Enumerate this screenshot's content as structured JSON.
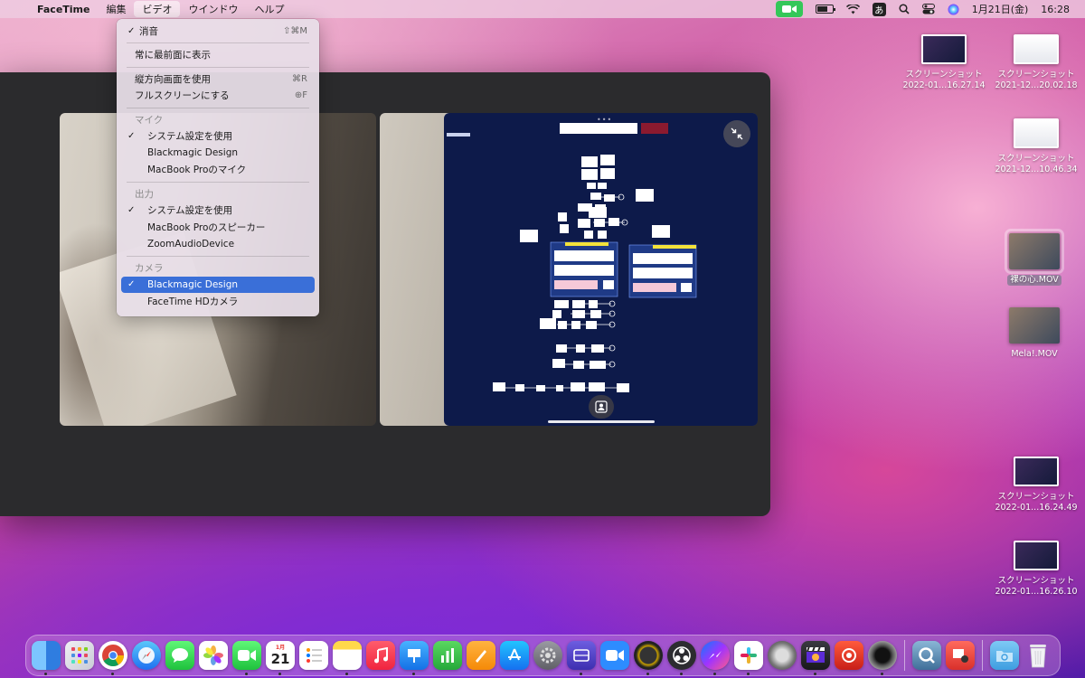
{
  "menubar": {
    "apple_glyph": "",
    "app_name": "FaceTime",
    "menus": [
      "編集",
      "ビデオ",
      "ウインドウ",
      "ヘルプ"
    ],
    "active_menu": "ビデオ",
    "input_method": "あ",
    "date": "1月21日(金)",
    "time": "16:28",
    "battery_level": 0.7
  },
  "video_menu": {
    "mute_label": "消音",
    "mute_shortcut": "⇧⌘M",
    "always_on_top_label": "常に最前面に表示",
    "portrait_label": "縦方向画面を使用",
    "portrait_shortcut": "⌘R",
    "fullscreen_label": "フルスクリーンにする",
    "fullscreen_shortcut": "⊕F",
    "mic_header": "マイク",
    "mic_items": [
      {
        "label": "システム設定を使用",
        "checked": true
      },
      {
        "label": "Blackmagic Design",
        "checked": false
      },
      {
        "label": "MacBook Proのマイク",
        "checked": false
      }
    ],
    "output_header": "出力",
    "output_items": [
      {
        "label": "システム設定を使用",
        "checked": true
      },
      {
        "label": "MacBook Proのスピーカー",
        "checked": false
      },
      {
        "label": "ZoomAudioDevice",
        "checked": false
      }
    ],
    "camera_header": "カメラ",
    "camera_items": [
      {
        "label": "Blackmagic Design",
        "checked": true
      },
      {
        "label": "FaceTime HDカメラ",
        "checked": false
      }
    ],
    "check_glyph": "✓"
  },
  "desktop_icons": [
    {
      "line1": "スクリーンショット",
      "line2": "2022-01...16.27.14"
    },
    {
      "line1": "スクリーンショット",
      "line2": "2021-12...20.02.18"
    },
    {
      "line1": "スクリーンショット",
      "line2": "2021-12...10.46.34"
    },
    {
      "line1": "裸の心.MOV",
      "line2": ""
    },
    {
      "line1": "Mela!.MOV",
      "line2": ""
    },
    {
      "line1": "スクリーンショット",
      "line2": "2022-01...16.24.49"
    },
    {
      "line1": "スクリーンショット",
      "line2": "2022-01...16.26.10"
    }
  ],
  "dock": {
    "calendar_day": "21",
    "calendar_month": "1月"
  },
  "colors": {
    "selection": "#3a6fd8",
    "camera_indicator": "#34c759",
    "share_background": "#0d1a4a"
  }
}
